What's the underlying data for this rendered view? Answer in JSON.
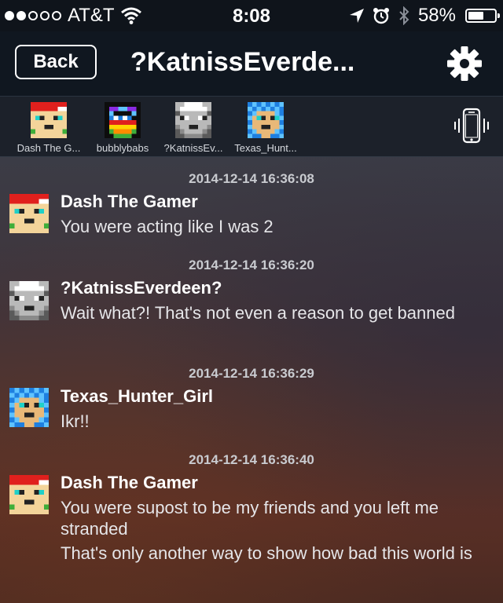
{
  "status_bar": {
    "carrier": "AT&T",
    "signal_bars": 2,
    "signal_total": 5,
    "time": "8:08",
    "battery_percent": "58%",
    "battery_level": 0.58
  },
  "nav": {
    "back_label": "Back",
    "title": "?KatnissEverde..."
  },
  "participants": [
    {
      "name": "Dash The G...",
      "avatar": "red-cap-skin"
    },
    {
      "name": "bubblybabs",
      "avatar": "rainbow-dark"
    },
    {
      "name": "?KatnissEv...",
      "avatar": "gray-hair"
    },
    {
      "name": "Texas_Hunt...",
      "avatar": "blue-hair"
    }
  ],
  "messages": [
    {
      "timestamp": "2014-12-14 16:36:08",
      "sender": "Dash The Gamer",
      "avatar": "red-cap-skin",
      "lines": [
        "You were acting like I was 2"
      ]
    },
    {
      "timestamp": "2014-12-14 16:36:20",
      "sender": "?KatnissEverdeen?",
      "avatar": "gray-hair",
      "lines": [
        "Wait what?! That's not even a reason to get banned"
      ]
    },
    {
      "timestamp": "2014-12-14 16:36:29",
      "sender": "Texas_Hunter_Girl",
      "avatar": "blue-hair",
      "lines": [
        "Ikr!!"
      ]
    },
    {
      "timestamp": "2014-12-14 16:36:40",
      "sender": "Dash The Gamer",
      "avatar": "red-cap-skin",
      "lines": [
        "You were supost to be my friends and you left me stranded",
        "That's only another way to show how bad this world is"
      ]
    }
  ],
  "icons": {
    "settings": "gear-icon",
    "vibrate": "phone-vibrate-icon",
    "wifi": "wifi-icon",
    "location": "location-arrow-icon",
    "alarm": "alarm-clock-icon",
    "bluetooth": "bluetooth-icon"
  },
  "colors": {
    "nav_background": "#101720",
    "participants_background": "#1c212a",
    "timestamp": "#c9cbd0"
  }
}
